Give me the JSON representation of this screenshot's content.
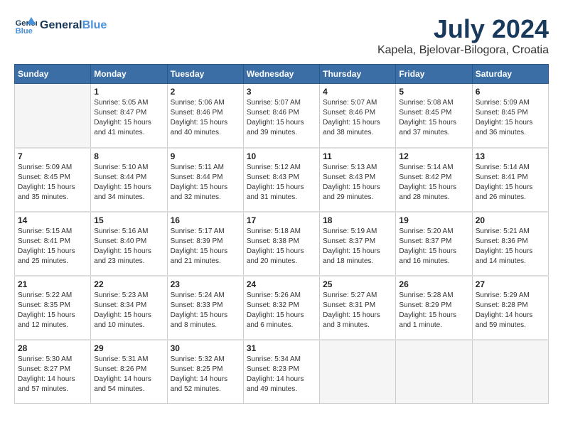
{
  "header": {
    "logo_general": "General",
    "logo_blue": "Blue",
    "month": "July 2024",
    "location": "Kapela, Bjelovar-Bilogora, Croatia"
  },
  "days_of_week": [
    "Sunday",
    "Monday",
    "Tuesday",
    "Wednesday",
    "Thursday",
    "Friday",
    "Saturday"
  ],
  "weeks": [
    [
      {
        "day": "",
        "info": ""
      },
      {
        "day": "1",
        "info": "Sunrise: 5:05 AM\nSunset: 8:47 PM\nDaylight: 15 hours\nand 41 minutes."
      },
      {
        "day": "2",
        "info": "Sunrise: 5:06 AM\nSunset: 8:46 PM\nDaylight: 15 hours\nand 40 minutes."
      },
      {
        "day": "3",
        "info": "Sunrise: 5:07 AM\nSunset: 8:46 PM\nDaylight: 15 hours\nand 39 minutes."
      },
      {
        "day": "4",
        "info": "Sunrise: 5:07 AM\nSunset: 8:46 PM\nDaylight: 15 hours\nand 38 minutes."
      },
      {
        "day": "5",
        "info": "Sunrise: 5:08 AM\nSunset: 8:45 PM\nDaylight: 15 hours\nand 37 minutes."
      },
      {
        "day": "6",
        "info": "Sunrise: 5:09 AM\nSunset: 8:45 PM\nDaylight: 15 hours\nand 36 minutes."
      }
    ],
    [
      {
        "day": "7",
        "info": "Sunrise: 5:09 AM\nSunset: 8:45 PM\nDaylight: 15 hours\nand 35 minutes."
      },
      {
        "day": "8",
        "info": "Sunrise: 5:10 AM\nSunset: 8:44 PM\nDaylight: 15 hours\nand 34 minutes."
      },
      {
        "day": "9",
        "info": "Sunrise: 5:11 AM\nSunset: 8:44 PM\nDaylight: 15 hours\nand 32 minutes."
      },
      {
        "day": "10",
        "info": "Sunrise: 5:12 AM\nSunset: 8:43 PM\nDaylight: 15 hours\nand 31 minutes."
      },
      {
        "day": "11",
        "info": "Sunrise: 5:13 AM\nSunset: 8:43 PM\nDaylight: 15 hours\nand 29 minutes."
      },
      {
        "day": "12",
        "info": "Sunrise: 5:14 AM\nSunset: 8:42 PM\nDaylight: 15 hours\nand 28 minutes."
      },
      {
        "day": "13",
        "info": "Sunrise: 5:14 AM\nSunset: 8:41 PM\nDaylight: 15 hours\nand 26 minutes."
      }
    ],
    [
      {
        "day": "14",
        "info": "Sunrise: 5:15 AM\nSunset: 8:41 PM\nDaylight: 15 hours\nand 25 minutes."
      },
      {
        "day": "15",
        "info": "Sunrise: 5:16 AM\nSunset: 8:40 PM\nDaylight: 15 hours\nand 23 minutes."
      },
      {
        "day": "16",
        "info": "Sunrise: 5:17 AM\nSunset: 8:39 PM\nDaylight: 15 hours\nand 21 minutes."
      },
      {
        "day": "17",
        "info": "Sunrise: 5:18 AM\nSunset: 8:38 PM\nDaylight: 15 hours\nand 20 minutes."
      },
      {
        "day": "18",
        "info": "Sunrise: 5:19 AM\nSunset: 8:37 PM\nDaylight: 15 hours\nand 18 minutes."
      },
      {
        "day": "19",
        "info": "Sunrise: 5:20 AM\nSunset: 8:37 PM\nDaylight: 15 hours\nand 16 minutes."
      },
      {
        "day": "20",
        "info": "Sunrise: 5:21 AM\nSunset: 8:36 PM\nDaylight: 15 hours\nand 14 minutes."
      }
    ],
    [
      {
        "day": "21",
        "info": "Sunrise: 5:22 AM\nSunset: 8:35 PM\nDaylight: 15 hours\nand 12 minutes."
      },
      {
        "day": "22",
        "info": "Sunrise: 5:23 AM\nSunset: 8:34 PM\nDaylight: 15 hours\nand 10 minutes."
      },
      {
        "day": "23",
        "info": "Sunrise: 5:24 AM\nSunset: 8:33 PM\nDaylight: 15 hours\nand 8 minutes."
      },
      {
        "day": "24",
        "info": "Sunrise: 5:26 AM\nSunset: 8:32 PM\nDaylight: 15 hours\nand 6 minutes."
      },
      {
        "day": "25",
        "info": "Sunrise: 5:27 AM\nSunset: 8:31 PM\nDaylight: 15 hours\nand 3 minutes."
      },
      {
        "day": "26",
        "info": "Sunrise: 5:28 AM\nSunset: 8:29 PM\nDaylight: 15 hours\nand 1 minute."
      },
      {
        "day": "27",
        "info": "Sunrise: 5:29 AM\nSunset: 8:28 PM\nDaylight: 14 hours\nand 59 minutes."
      }
    ],
    [
      {
        "day": "28",
        "info": "Sunrise: 5:30 AM\nSunset: 8:27 PM\nDaylight: 14 hours\nand 57 minutes."
      },
      {
        "day": "29",
        "info": "Sunrise: 5:31 AM\nSunset: 8:26 PM\nDaylight: 14 hours\nand 54 minutes."
      },
      {
        "day": "30",
        "info": "Sunrise: 5:32 AM\nSunset: 8:25 PM\nDaylight: 14 hours\nand 52 minutes."
      },
      {
        "day": "31",
        "info": "Sunrise: 5:34 AM\nSunset: 8:23 PM\nDaylight: 14 hours\nand 49 minutes."
      },
      {
        "day": "",
        "info": ""
      },
      {
        "day": "",
        "info": ""
      },
      {
        "day": "",
        "info": ""
      }
    ]
  ]
}
